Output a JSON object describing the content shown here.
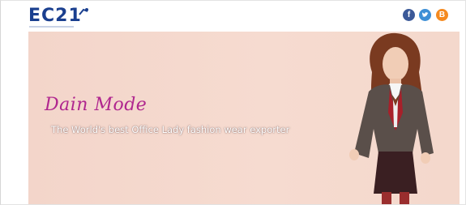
{
  "header": {
    "logo_text": "EC21",
    "social": [
      {
        "name": "facebook",
        "icon": "facebook-icon",
        "glyph": "f",
        "color": "#3b5998"
      },
      {
        "name": "twitter",
        "icon": "twitter-icon",
        "glyph": "",
        "color": "#3d8fd6"
      },
      {
        "name": "blog",
        "icon": "blog-icon",
        "glyph": "B",
        "color": "#f58a1f"
      }
    ]
  },
  "banner": {
    "brand": "Dain Mode",
    "tagline": "The World's best Office Lady fashion wear exporter",
    "background": "#f4d8cc"
  }
}
